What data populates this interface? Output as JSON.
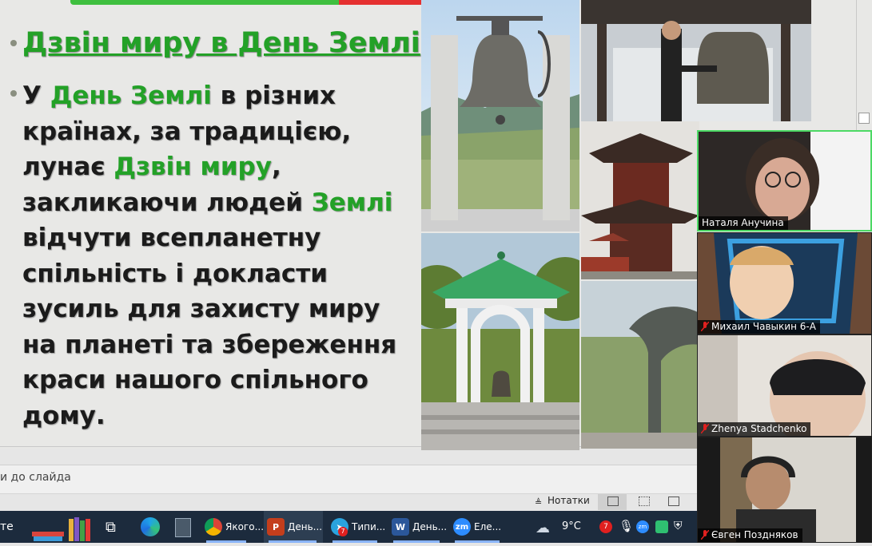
{
  "slide": {
    "title": "Дзвін миру в День Землі",
    "body_segments": [
      {
        "text": "У ",
        "hl": false
      },
      {
        "text": "День Землі",
        "hl": true
      },
      {
        "text": " в різних країнах, за традицією, лунає ",
        "hl": false
      },
      {
        "text": "Дзвін миру",
        "hl": true
      },
      {
        "text": ", закликаючи людей ",
        "hl": false
      },
      {
        "text": "Землі",
        "hl": true
      },
      {
        "text": " відчути всепланетну спільність і докласти зусиль для захисту миру на планеті та збереження краси нашого спільного дому.",
        "hl": false
      }
    ],
    "progress_fraction": 0.56
  },
  "notes_placeholder": "и до слайда",
  "status_bar": {
    "notes_label": "Нотатки"
  },
  "taskbar": {
    "left_text": "те",
    "apps": [
      {
        "label": "Якого...",
        "icon": "chrome-icon"
      },
      {
        "label": "День...",
        "icon": "powerpoint-icon"
      },
      {
        "label": "Типи...",
        "icon": "telegram-icon",
        "badge": "7"
      },
      {
        "label": "День...",
        "icon": "word-icon"
      },
      {
        "label": "Еле...",
        "icon": "zoom-icon"
      }
    ],
    "weather": "9°C",
    "tray_badge": "7",
    "ppt_icon_letter": "P",
    "word_icon_letter": "W",
    "zoom_icon_letters": "zm"
  },
  "participants": [
    {
      "name": "Наталя Анучина",
      "muted": false
    },
    {
      "name": "Михаил Чавыкин 6-А",
      "muted": true
    },
    {
      "name": "Zhenya Stadchenko",
      "muted": true
    },
    {
      "name": "Євген Поздняков",
      "muted": true
    }
  ],
  "colors": {
    "accent_green": "#23a127",
    "taskbar": "#1c2b3d",
    "muted_red": "#e0201f"
  }
}
